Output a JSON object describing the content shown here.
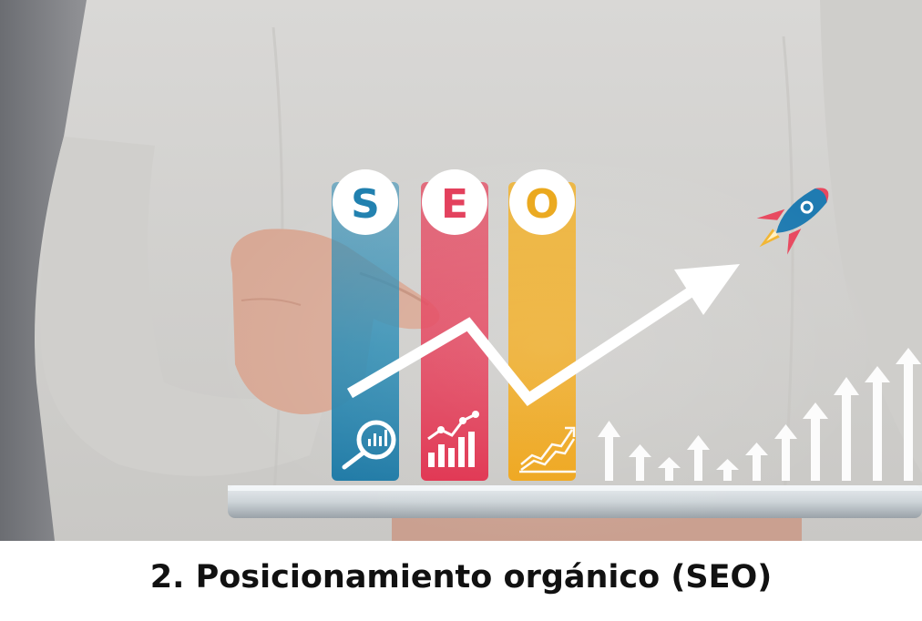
{
  "hero": {
    "badge_letters": [
      {
        "letter": "S",
        "color": "#1e7fae"
      },
      {
        "letter": "E",
        "color": "#e23b58"
      },
      {
        "letter": "O",
        "color": "#eaa617"
      }
    ],
    "colors": {
      "blue": "#2a8bb3",
      "red": "#e6475f",
      "yellow": "#f0ad1e",
      "arrow": "#ffffff",
      "rocket_body": "#1f7bb1",
      "rocket_fin": "#e8485e",
      "rocket_flame": "#f2b531"
    },
    "icons": [
      "magnifier-chart-icon",
      "bar-chart-icon",
      "line-chart-icon",
      "rocket-icon",
      "trend-arrow-icon"
    ]
  },
  "caption": {
    "title": "2. Posicionamiento orgánico (SEO)"
  }
}
